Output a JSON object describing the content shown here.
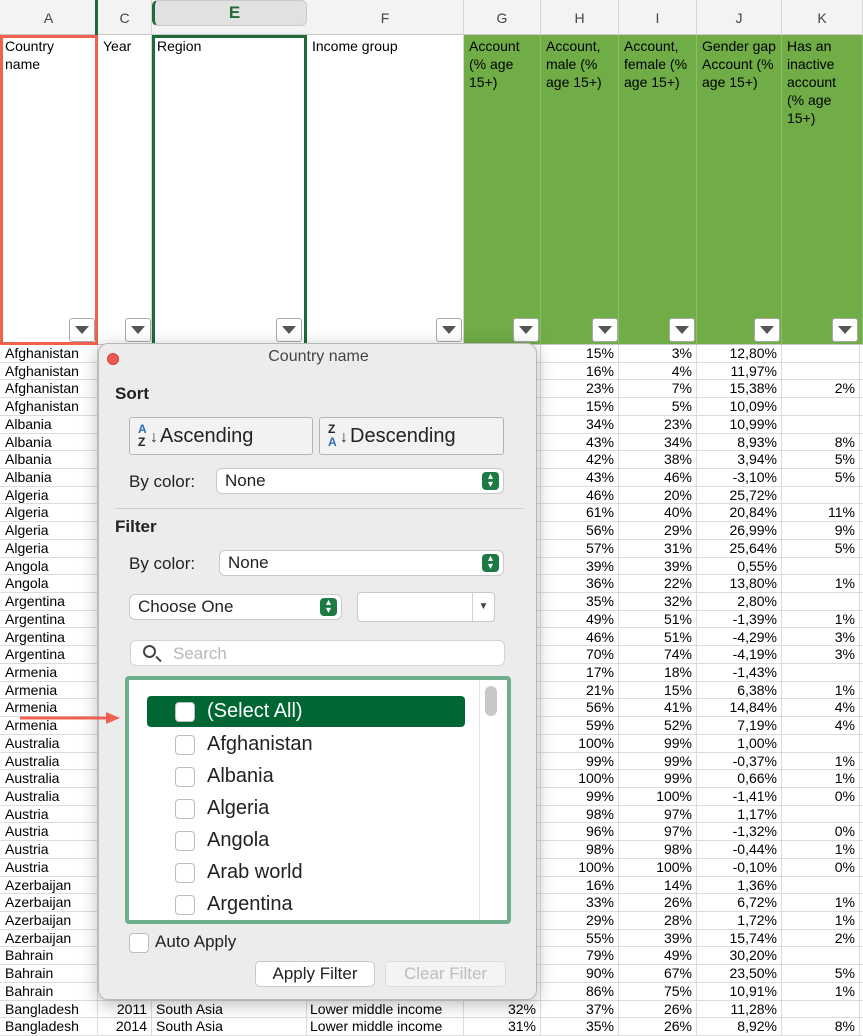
{
  "columns": [
    "A",
    "C",
    "E",
    "F",
    "G",
    "H",
    "I",
    "J",
    "K"
  ],
  "headers": {
    "a": "Country name",
    "c": "Year",
    "e": "Region",
    "f": "Income group",
    "g": "Account (% age 15+)",
    "h": "Account, male (% age 15+)",
    "i": "Account, female (% age 15+)",
    "j": "Gender gap Account (% age 15+)",
    "k": "Has an inactive account (% age 15+)"
  },
  "rows": [
    {
      "a": "Afghanistan",
      "c": "",
      "e": "",
      "f": "",
      "g": "",
      "h": "15%",
      "i": "3%",
      "j": "12,80%",
      "k": ""
    },
    {
      "a": "Afghanistan",
      "c": "",
      "e": "",
      "f": "",
      "g": "",
      "h": "16%",
      "i": "4%",
      "j": "11,97%",
      "k": ""
    },
    {
      "a": "Afghanistan",
      "c": "",
      "e": "",
      "f": "",
      "g": "",
      "h": "23%",
      "i": "7%",
      "j": "15,38%",
      "k": "2%"
    },
    {
      "a": "Afghanistan",
      "c": "",
      "e": "",
      "f": "",
      "g": "",
      "h": "15%",
      "i": "5%",
      "j": "10,09%",
      "k": ""
    },
    {
      "a": "Albania",
      "c": "",
      "e": "",
      "f": "",
      "g": "",
      "h": "34%",
      "i": "23%",
      "j": "10,99%",
      "k": ""
    },
    {
      "a": "Albania",
      "c": "",
      "e": "",
      "f": "",
      "g": "",
      "h": "43%",
      "i": "34%",
      "j": "8,93%",
      "k": "8%"
    },
    {
      "a": "Albania",
      "c": "",
      "e": "",
      "f": "",
      "g": "",
      "h": "42%",
      "i": "38%",
      "j": "3,94%",
      "k": "5%"
    },
    {
      "a": "Albania",
      "c": "",
      "e": "",
      "f": "",
      "g": "",
      "h": "43%",
      "i": "46%",
      "j": "-3,10%",
      "k": "5%"
    },
    {
      "a": "Algeria",
      "c": "",
      "e": "",
      "f": "",
      "g": "",
      "h": "46%",
      "i": "20%",
      "j": "25,72%",
      "k": ""
    },
    {
      "a": "Algeria",
      "c": "",
      "e": "",
      "f": "",
      "g": "",
      "h": "61%",
      "i": "40%",
      "j": "20,84%",
      "k": "11%"
    },
    {
      "a": "Algeria",
      "c": "",
      "e": "",
      "f": "",
      "g": "",
      "h": "56%",
      "i": "29%",
      "j": "26,99%",
      "k": "9%"
    },
    {
      "a": "Algeria",
      "c": "",
      "e": "",
      "f": "",
      "g": "",
      "h": "57%",
      "i": "31%",
      "j": "25,64%",
      "k": "5%"
    },
    {
      "a": "Angola",
      "c": "",
      "e": "",
      "f": "",
      "g": "",
      "h": "39%",
      "i": "39%",
      "j": "0,55%",
      "k": ""
    },
    {
      "a": "Angola",
      "c": "",
      "e": "",
      "f": "",
      "g": "",
      "h": "36%",
      "i": "22%",
      "j": "13,80%",
      "k": "1%"
    },
    {
      "a": "Argentina",
      "c": "",
      "e": "",
      "f": "",
      "g": "",
      "h": "35%",
      "i": "32%",
      "j": "2,80%",
      "k": ""
    },
    {
      "a": "Argentina",
      "c": "",
      "e": "",
      "f": "",
      "g": "",
      "h": "49%",
      "i": "51%",
      "j": "-1,39%",
      "k": "1%"
    },
    {
      "a": "Argentina",
      "c": "",
      "e": "",
      "f": "",
      "g": "",
      "h": "46%",
      "i": "51%",
      "j": "-4,29%",
      "k": "3%"
    },
    {
      "a": "Argentina",
      "c": "",
      "e": "",
      "f": "",
      "g": "",
      "h": "70%",
      "i": "74%",
      "j": "-4,19%",
      "k": "3%"
    },
    {
      "a": "Armenia",
      "c": "",
      "e": "",
      "f": "",
      "g": "",
      "h": "17%",
      "i": "18%",
      "j": "-1,43%",
      "k": ""
    },
    {
      "a": "Armenia",
      "c": "",
      "e": "",
      "f": "",
      "g": "",
      "h": "21%",
      "i": "15%",
      "j": "6,38%",
      "k": "1%"
    },
    {
      "a": "Armenia",
      "c": "",
      "e": "",
      "f": "",
      "g": "",
      "h": "56%",
      "i": "41%",
      "j": "14,84%",
      "k": "4%"
    },
    {
      "a": "Armenia",
      "c": "",
      "e": "",
      "f": "",
      "g": "",
      "h": "59%",
      "i": "52%",
      "j": "7,19%",
      "k": "4%"
    },
    {
      "a": "Australia",
      "c": "",
      "e": "",
      "f": "",
      "g": "",
      "h": "100%",
      "i": "99%",
      "j": "1,00%",
      "k": ""
    },
    {
      "a": "Australia",
      "c": "",
      "e": "",
      "f": "",
      "g": "",
      "h": "99%",
      "i": "99%",
      "j": "-0,37%",
      "k": "1%"
    },
    {
      "a": "Australia",
      "c": "",
      "e": "",
      "f": "",
      "g": "",
      "h": "100%",
      "i": "99%",
      "j": "0,66%",
      "k": "1%"
    },
    {
      "a": "Australia",
      "c": "",
      "e": "",
      "f": "",
      "g": "",
      "h": "99%",
      "i": "100%",
      "j": "-1,41%",
      "k": "0%"
    },
    {
      "a": "Austria",
      "c": "",
      "e": "",
      "f": "",
      "g": "",
      "h": "98%",
      "i": "97%",
      "j": "1,17%",
      "k": ""
    },
    {
      "a": "Austria",
      "c": "",
      "e": "",
      "f": "",
      "g": "",
      "h": "96%",
      "i": "97%",
      "j": "-1,32%",
      "k": "0%"
    },
    {
      "a": "Austria",
      "c": "",
      "e": "",
      "f": "",
      "g": "",
      "h": "98%",
      "i": "98%",
      "j": "-0,44%",
      "k": "1%"
    },
    {
      "a": "Austria",
      "c": "",
      "e": "",
      "f": "",
      "g": "",
      "h": "100%",
      "i": "100%",
      "j": "-0,10%",
      "k": "0%"
    },
    {
      "a": "Azerbaijan",
      "c": "",
      "e": "",
      "f": "",
      "g": "",
      "h": "16%",
      "i": "14%",
      "j": "1,36%",
      "k": ""
    },
    {
      "a": "Azerbaijan",
      "c": "",
      "e": "",
      "f": "",
      "g": "",
      "h": "33%",
      "i": "26%",
      "j": "6,72%",
      "k": "1%"
    },
    {
      "a": "Azerbaijan",
      "c": "",
      "e": "",
      "f": "",
      "g": "",
      "h": "29%",
      "i": "28%",
      "j": "1,72%",
      "k": "1%"
    },
    {
      "a": "Azerbaijan",
      "c": "",
      "e": "",
      "f": "",
      "g": "",
      "h": "55%",
      "i": "39%",
      "j": "15,74%",
      "k": "2%"
    },
    {
      "a": "Bahrain",
      "c": "",
      "e": "",
      "f": "",
      "g": "",
      "h": "79%",
      "i": "49%",
      "j": "30,20%",
      "k": ""
    },
    {
      "a": "Bahrain",
      "c": "",
      "e": "",
      "f": "",
      "g": "",
      "h": "90%",
      "i": "67%",
      "j": "23,50%",
      "k": "5%"
    },
    {
      "a": "Bahrain",
      "c": "",
      "e": "",
      "f": "",
      "g": "",
      "h": "86%",
      "i": "75%",
      "j": "10,91%",
      "k": "1%"
    },
    {
      "a": "Bangladesh",
      "c": "2011",
      "e": "South Asia",
      "f": "Lower middle income",
      "g": "32%",
      "h": "37%",
      "i": "26%",
      "j": "11,28%",
      "k": ""
    },
    {
      "a": "Bangladesh",
      "c": "2014",
      "e": "South Asia",
      "f": "Lower middle income",
      "g": "31%",
      "h": "35%",
      "i": "26%",
      "j": "8,92%",
      "k": "8%"
    }
  ],
  "popup": {
    "title": "Country name",
    "sort_heading": "Sort",
    "ascending_label": "Ascending",
    "descending_label": "Descending",
    "sort_by_color_label": "By color:",
    "sort_by_color_value": "None",
    "filter_heading": "Filter",
    "filter_by_color_label": "By color:",
    "filter_by_color_value": "None",
    "condition_value": "Choose One",
    "condition_input_value": "",
    "search_placeholder": "Search",
    "list_items": [
      "(Select All)",
      "Afghanistan",
      "Albania",
      "Algeria",
      "Angola",
      "Arab world",
      "Argentina"
    ],
    "auto_apply_label": "Auto Apply",
    "apply_label": "Apply Filter",
    "clear_label": "Clear Filter"
  },
  "colors": {
    "accent_green": "#006633",
    "header_fill": "#70ad47",
    "highlight_red": "#f0624f"
  }
}
